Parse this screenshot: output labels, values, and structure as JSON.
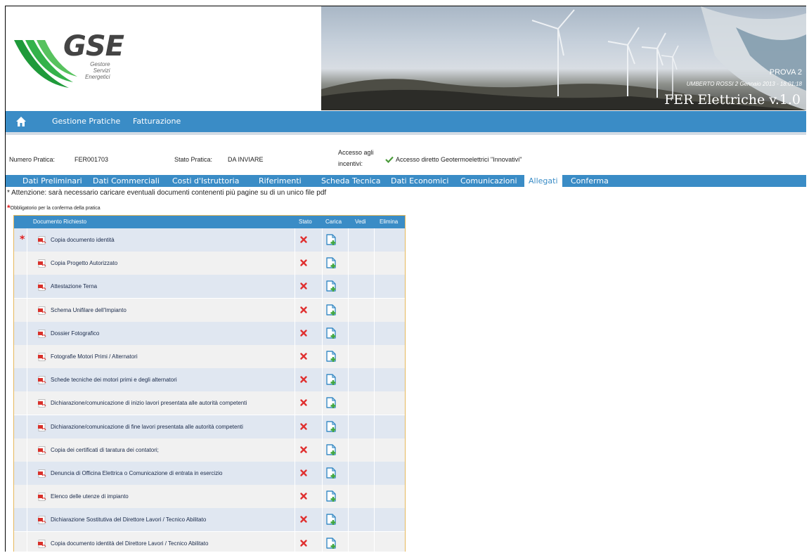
{
  "header": {
    "logo_text": "GSE",
    "logo_sub": [
      "Gestore",
      "Servizi",
      "Energetici"
    ],
    "banner_label": "PROVA 2",
    "banner_user": "UMBERTO ROSSI 2 Gennaio 2013 - 18:01:18",
    "banner_title": "FER Elettriche  v.1.0"
  },
  "nav": {
    "items": [
      "Gestione Pratiche",
      "Fatturazione"
    ]
  },
  "info": {
    "numero_label": "Numero Pratica:",
    "numero_value": "FER001703",
    "stato_label": "Stato Pratica:",
    "stato_value": "DA INVIARE",
    "accesso_label_1": "Accesso agli",
    "accesso_label_2": "incentivi:",
    "accesso_value": "Accesso diretto Geotermoelettrici \"Innovativi\""
  },
  "tabs": [
    "Dati Preliminari",
    "Dati Commerciali",
    "Costi d'Istruttoria",
    "Riferimenti",
    "Scheda Tecnica",
    "Dati Economici",
    "Comunicazioni",
    "Allegati",
    "Conferma"
  ],
  "active_tab": "Allegati",
  "notice": "* Attenzione: sarà necessario caricare eventuali documenti contenenti più pagine su di un unico file pdf",
  "required_note": "Obbligatorio per la conferma della pratica",
  "table": {
    "headers": {
      "documento": "Documento Richiesto",
      "stato": "Stato",
      "carica": "Carica",
      "vedi": "Vedi",
      "elimina": "Elimina"
    },
    "rows": [
      {
        "label": "Copia documento identità",
        "required": true
      },
      {
        "label": "Copia Progetto Autorizzato",
        "required": false
      },
      {
        "label": "Attestazione Terna",
        "required": false
      },
      {
        "label": "Schema Unifilare dell'Impianto",
        "required": false
      },
      {
        "label": "Dossier Fotografico",
        "required": false
      },
      {
        "label": "Fotografie Motori Primi / Alternatori",
        "required": false
      },
      {
        "label": "Schede tecniche dei motori primi e degli alternatori",
        "required": false
      },
      {
        "label": "Dichiarazione/comunicazione di inizio lavori presentata alle autorità competenti",
        "required": false
      },
      {
        "label": "Dichiarazione/comunicazione di fine lavori presentata alle autorità competenti",
        "required": false
      },
      {
        "label": "Copia dei certificati di taratura dei contatori;",
        "required": false
      },
      {
        "label": "Denuncia di Officina Elettrica o Comunicazione di entrata in esercizio",
        "required": false
      },
      {
        "label": "Elenco delle utenze di impianto",
        "required": false
      },
      {
        "label": "Dichiarazione Sostitutiva del Direttore Lavori / Tecnico Abilitato",
        "required": false
      },
      {
        "label": "Copia documento identità del Direttore Lavori / Tecnico Abilitato",
        "required": false
      }
    ]
  },
  "colors": {
    "primary": "#3a8cc6",
    "row_alt": "#e0e7f1",
    "required_star": "#e02020",
    "status_missing": "#e03030",
    "table_border": "#e6b85c"
  },
  "icons": {
    "home": "home-icon",
    "check": "check-icon",
    "pdf": "pdf-icon",
    "status": "x-icon",
    "upload": "add-document-icon"
  }
}
